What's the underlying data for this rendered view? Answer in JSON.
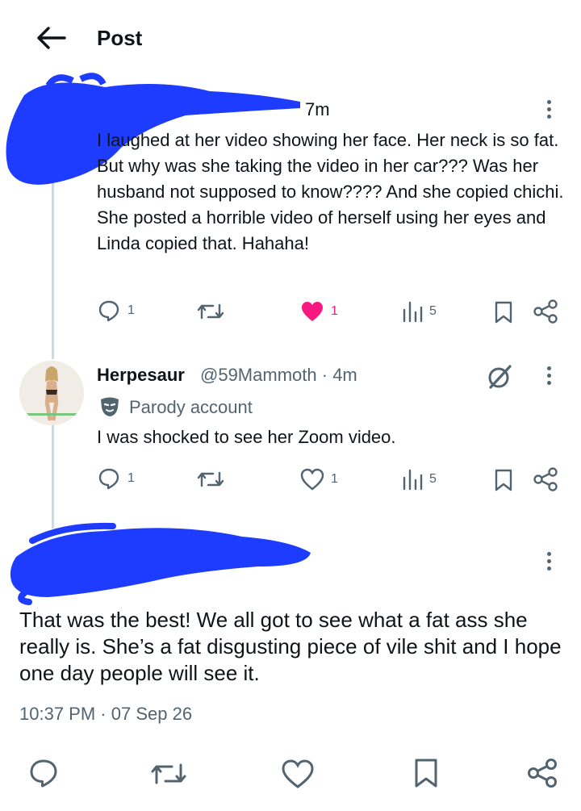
{
  "header": {
    "title": "Post"
  },
  "tweet1": {
    "time": "7m",
    "text": "I laughed at her video showing her face. Her neck is so fat. But why was she taking the video in her car??? Was her husband not supposed to know???? And she copied chichi. She posted a horrible video of herself using her eyes and Linda copied that. Hahaha!",
    "replies": "1",
    "likes": "1",
    "views": "5",
    "liked": true
  },
  "tweet2": {
    "name": "Herpesaur",
    "handle": "@59Mammoth",
    "time": "4m",
    "badge": "Parody account",
    "text": "I was shocked to see her Zoom video.",
    "replies": "1",
    "likes": "1",
    "views": "5"
  },
  "main_tweet": {
    "text": "That was the best! We all got to see what a fat ass she really is. She’s a fat disgusting piece of vile shit and I hope one day people will see it.",
    "time": "10:37 PM",
    "date": "07 Sep 26"
  },
  "colors": {
    "like_active": "#f91880",
    "scribble": "#1e3cff",
    "muted": "#536471"
  },
  "icons": [
    "back-arrow-icon",
    "reply-icon",
    "retweet-icon",
    "heart-icon",
    "views-icon",
    "bookmark-icon",
    "share-icon",
    "more-icon",
    "grok-icon",
    "parody-mask-icon"
  ]
}
